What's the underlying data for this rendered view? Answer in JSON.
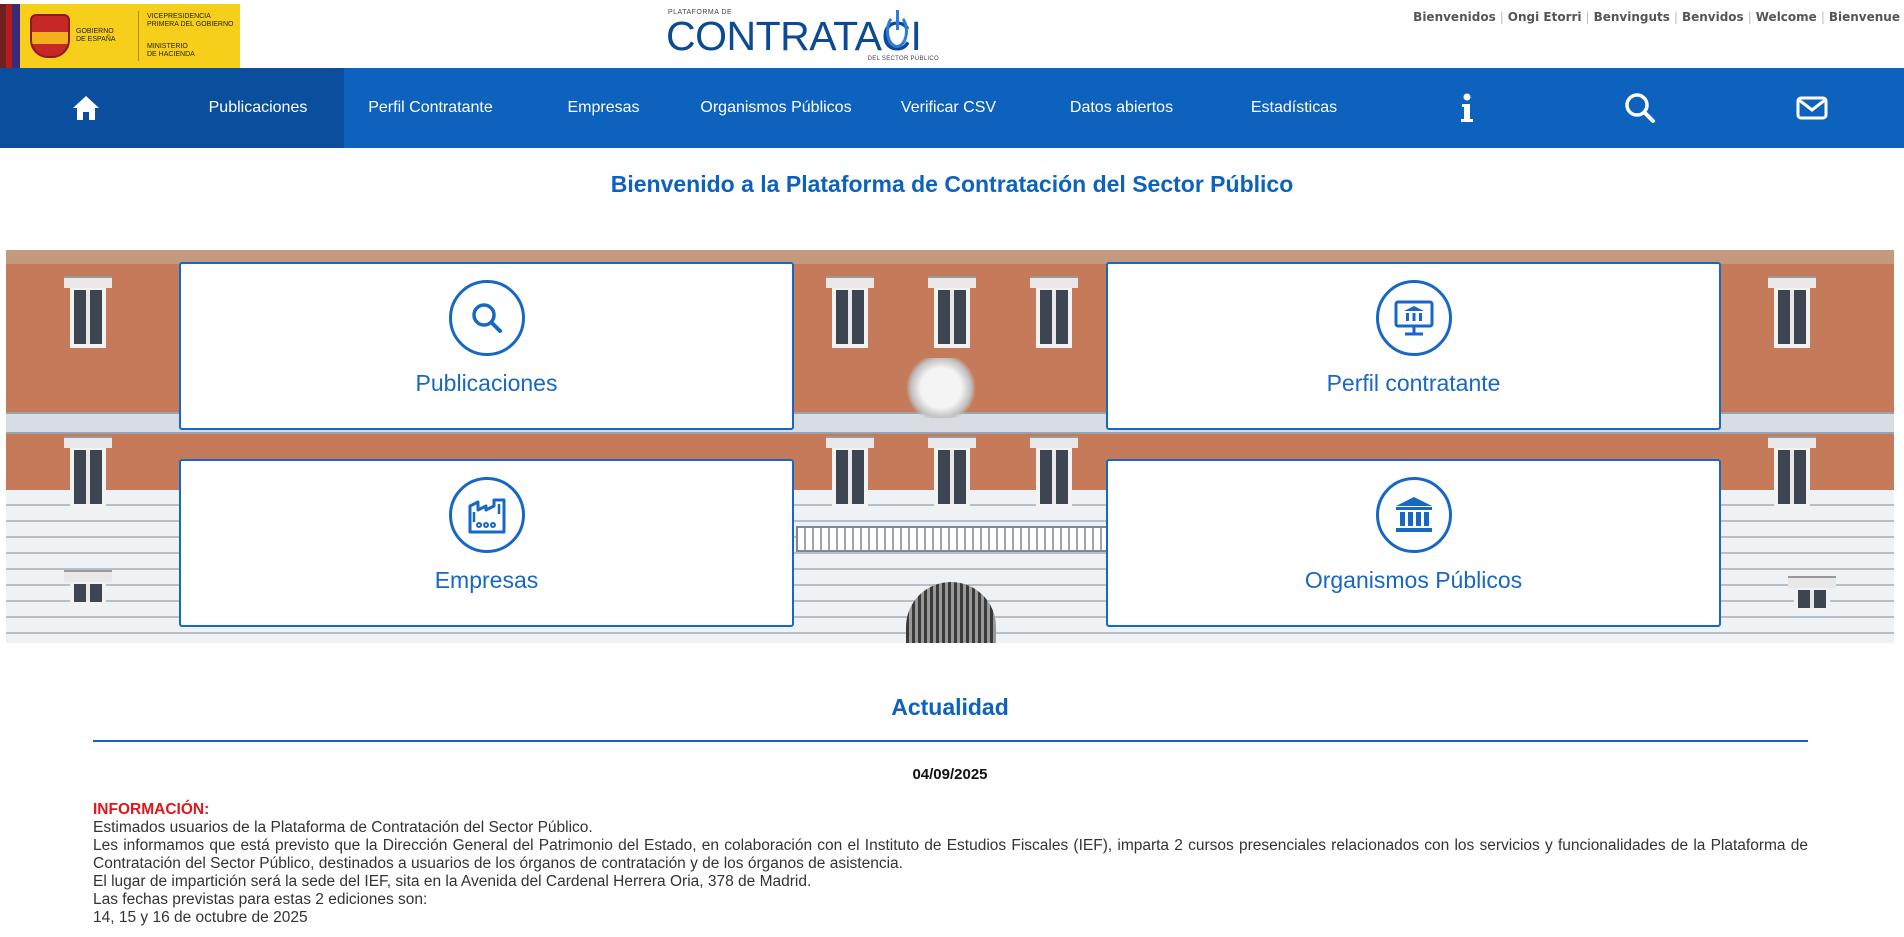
{
  "header": {
    "gov": {
      "country_line1": "GOBIERNO",
      "country_line2": "DE ESPAÑA",
      "vice_line1": "VICEPRESIDENCIA",
      "vice_line2": "PRIMERA DEL GOBIERNO",
      "ministry_line1": "MINISTERIO",
      "ministry_line2": "DE HACIENDA"
    },
    "platform": {
      "top": "PLATAFORMA DE",
      "main": "CONTRATACI",
      "main_end": "N",
      "sub": "DEL SECTOR PÚBLICO"
    },
    "languages": [
      "Bienvenidos",
      "Ongi Etorri",
      "Benvinguts",
      "Benvidos",
      "Welcome",
      "Bienvenue"
    ]
  },
  "nav": {
    "home_icon": "home-icon",
    "items": [
      {
        "label": "Publicaciones",
        "active": true
      },
      {
        "label": "Perfil Contratante"
      },
      {
        "label": "Empresas"
      },
      {
        "label": "Organismos Públicos"
      },
      {
        "label": "Verificar CSV"
      },
      {
        "label": "Datos abiertos"
      },
      {
        "label": "Estadísticas"
      }
    ],
    "icons": [
      "info-icon",
      "search-icon",
      "mail-icon"
    ]
  },
  "welcome_title": "Bienvenido a la Plataforma de Contratación del Sector Público",
  "cards": [
    {
      "label": "Publicaciones",
      "icon": "magnifier-icon"
    },
    {
      "label": "Perfil contratante",
      "icon": "monitor-institution-icon"
    },
    {
      "label": "Empresas",
      "icon": "factory-icon"
    },
    {
      "label": "Organismos Públicos",
      "icon": "institution-icon"
    }
  ],
  "news": {
    "section_title": "Actualidad",
    "date": "04/09/2025",
    "label": "INFORMACIÓN:",
    "lines": [
      "Estimados usuarios de la Plataforma de Contratación del Sector Público.",
      "Les informamos que está previsto que la Dirección General del Patrimonio del Estado, en colaboración con el Instituto de Estudios Fiscales (IEF), imparta 2 cursos presenciales relacionados con los servicios y funcionalidades de la Plataforma de Contratación del Sector Público, destinados a usuarios de los órganos de contratación y de los órganos de asistencia.",
      "El lugar de impartición será la sede del IEF, sita en la Avenida del Cardenal Herrera Oria, 378 de Madrid.",
      "Las fechas previstas para estas 2 ediciones son:",
      "14, 15 y 16 de octubre de 2025"
    ]
  },
  "colors": {
    "brand_blue": "#0d62bd",
    "nav_active": "#0a4f9e",
    "card_blue": "#1767c4",
    "alert_red": "#e0161b"
  }
}
